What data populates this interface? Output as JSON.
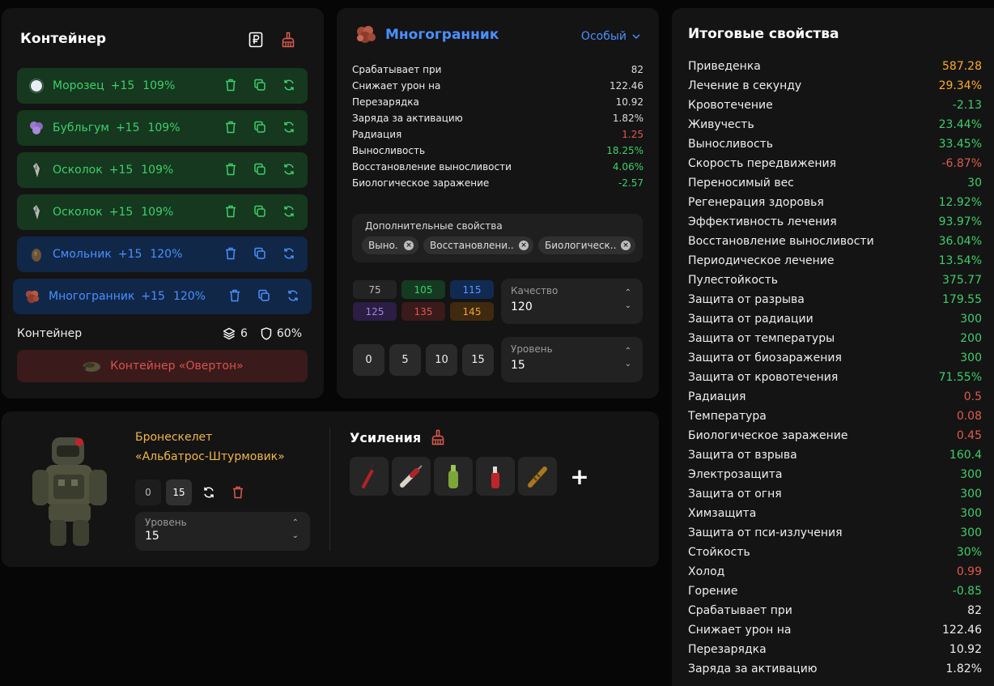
{
  "container": {
    "title": "Контейнер",
    "slots": [
      {
        "name": "Морозец",
        "level": "+15",
        "pct": "109%",
        "style": "green",
        "icon": "snowball-icon"
      },
      {
        "name": "Бубльгум",
        "level": "+15",
        "pct": "109%",
        "style": "green",
        "icon": "purple-gem-icon"
      },
      {
        "name": "Осколок",
        "level": "+15",
        "pct": "109%",
        "style": "green",
        "icon": "shard-icon"
      },
      {
        "name": "Осколок",
        "level": "+15",
        "pct": "109%",
        "style": "green",
        "icon": "shard-icon"
      },
      {
        "name": "Смольник",
        "level": "+15",
        "pct": "120%",
        "style": "blue",
        "icon": "resin-icon"
      },
      {
        "name": "Многогранник",
        "level": "+15",
        "pct": "120%",
        "style": "blue",
        "icon": "polyhedron-icon"
      }
    ],
    "footer_label": "Контейнер",
    "slots_count": "6",
    "protection": "60%",
    "container_name": "Контейнер «Овертон»"
  },
  "artifact": {
    "name": "Многогранник",
    "rarity": "Особый",
    "stats": [
      {
        "label": "Срабатывает при",
        "value": "82",
        "color": "white"
      },
      {
        "label": "Снижает урон на",
        "value": "122.46",
        "color": "white"
      },
      {
        "label": "Перезарядка",
        "value": "10.92",
        "color": "white"
      },
      {
        "label": "Заряда за активацию",
        "value": "1.82%",
        "color": "white"
      },
      {
        "label": "Радиация",
        "value": "1.25",
        "color": "red"
      },
      {
        "label": "Выносливость",
        "value": "18.25%",
        "color": "green"
      },
      {
        "label": "Восстановление выносливости",
        "value": "4.06%",
        "color": "green"
      },
      {
        "label": "Биологическое заражение",
        "value": "-2.57",
        "color": "green"
      }
    ],
    "extra_label": "Дополнительные свойства",
    "extra_chips": [
      "Выно...",
      "Восстановлени...",
      "Биологическ..."
    ],
    "quality_values": [
      "75",
      "105",
      "115",
      "125",
      "135",
      "145"
    ],
    "quality_label": "Качество",
    "quality_value": "120",
    "level_buttons": [
      "0",
      "5",
      "10",
      "15"
    ],
    "level_label": "Уровень",
    "level_value": "15"
  },
  "armor": {
    "name_line1": "Бронескелет",
    "name_line2": "«Альбатрос-Штурмовик»",
    "btn_min": "0",
    "btn_max": "15",
    "level_label": "Уровень",
    "level_value": "15",
    "boosts_title": "Усиления"
  },
  "summary": {
    "title": "Итоговые свойства",
    "rows": [
      {
        "label": "Приведенка",
        "value": "587.28",
        "color": "orange"
      },
      {
        "label": "Лечение в секунду",
        "value": "29.34%",
        "color": "orange"
      },
      {
        "label": "Кровотечение",
        "value": "-2.13",
        "color": "green"
      },
      {
        "label": "Живучесть",
        "value": "23.44%",
        "color": "green"
      },
      {
        "label": "Выносливость",
        "value": "33.45%",
        "color": "green"
      },
      {
        "label": "Скорость передвижения",
        "value": "-6.87%",
        "color": "red"
      },
      {
        "label": "Переносимый вес",
        "value": "30",
        "color": "green"
      },
      {
        "label": "Регенерация здоровья",
        "value": "12.92%",
        "color": "green"
      },
      {
        "label": "Эффективность лечения",
        "value": "93.97%",
        "color": "green"
      },
      {
        "label": "Восстановление выносливости",
        "value": "36.04%",
        "color": "green"
      },
      {
        "label": "Периодическое лечение",
        "value": "13.54%",
        "color": "green"
      },
      {
        "label": "Пулестойкость",
        "value": "375.77",
        "color": "green"
      },
      {
        "label": "Защита от разрыва",
        "value": "179.55",
        "color": "green"
      },
      {
        "label": "Защита от радиации",
        "value": "300",
        "color": "green"
      },
      {
        "label": "Защита от температуры",
        "value": "200",
        "color": "green"
      },
      {
        "label": "Защита от биозаражения",
        "value": "300",
        "color": "green"
      },
      {
        "label": "Защита от кровотечения",
        "value": "71.55%",
        "color": "green"
      },
      {
        "label": "Радиация",
        "value": "0.5",
        "color": "red"
      },
      {
        "label": "Температура",
        "value": "0.08",
        "color": "red"
      },
      {
        "label": "Биологическое заражение",
        "value": "0.45",
        "color": "red"
      },
      {
        "label": "Защита от взрыва",
        "value": "160.4",
        "color": "green"
      },
      {
        "label": "Электрозащита",
        "value": "300",
        "color": "green"
      },
      {
        "label": "Защита от огня",
        "value": "300",
        "color": "green"
      },
      {
        "label": "Химзащита",
        "value": "300",
        "color": "green"
      },
      {
        "label": "Защита от пси-излучения",
        "value": "300",
        "color": "green"
      },
      {
        "label": "Стойкость",
        "value": "30%",
        "color": "green"
      },
      {
        "label": "Холод",
        "value": "0.99",
        "color": "red"
      },
      {
        "label": "Горение",
        "value": "-0.85",
        "color": "green"
      },
      {
        "label": "Срабатывает при",
        "value": "82",
        "color": "white"
      },
      {
        "label": "Снижает урон на",
        "value": "122.46",
        "color": "white"
      },
      {
        "label": "Перезарядка",
        "value": "10.92",
        "color": "white"
      },
      {
        "label": "Заряда за активацию",
        "value": "1.82%",
        "color": "white"
      }
    ]
  },
  "colors": {
    "green": "#3fce6a",
    "blue": "#4b8fff",
    "red": "#e05a4e",
    "orange": "#ffab2e",
    "gold": "#f0b64a"
  }
}
